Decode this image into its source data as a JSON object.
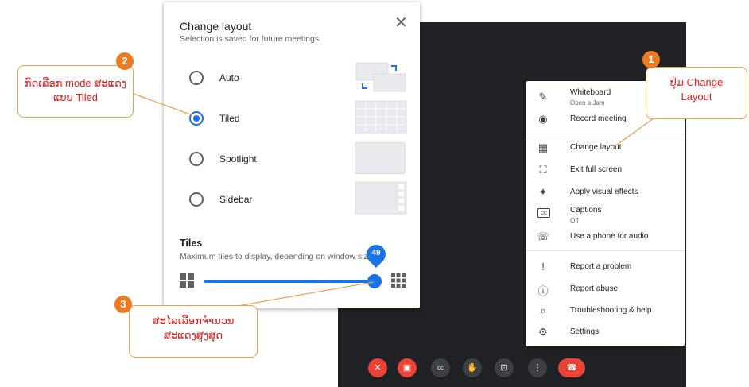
{
  "change_layout": {
    "title": "Change layout",
    "subtitle": "Selection is saved for future meetings",
    "close_icon": "close-icon",
    "options": [
      {
        "label": "Auto",
        "selected": false
      },
      {
        "label": "Tiled",
        "selected": true
      },
      {
        "label": "Spotlight",
        "selected": false
      },
      {
        "label": "Sidebar",
        "selected": false
      }
    ],
    "tiles_title": "Tiles",
    "tiles_desc": "Maximum tiles to display, depending on window size.",
    "slider_value": "49"
  },
  "menu": {
    "items": [
      {
        "icon": "pen-icon",
        "glyph": "✎",
        "label": "Whiteboard",
        "sub": "Open a Jam"
      },
      {
        "icon": "record-icon",
        "glyph": "◉",
        "label": "Record meeting"
      },
      {
        "icon": "layout-icon",
        "glyph": "▦",
        "label": "Change layout"
      },
      {
        "icon": "exit-fullscreen-icon",
        "glyph": "⛶",
        "label": "Exit full screen"
      },
      {
        "icon": "sparkle-icon",
        "glyph": "✦",
        "label": "Apply visual effects"
      },
      {
        "icon": "captions-icon",
        "glyph": "cc",
        "label": "Captions",
        "sub": "Off"
      },
      {
        "icon": "phone-icon",
        "glyph": "☏",
        "label": "Use a phone for audio"
      },
      {
        "icon": "report-problem-icon",
        "glyph": "!",
        "label": "Report a problem"
      },
      {
        "icon": "report-abuse-icon",
        "glyph": "ⓘ",
        "label": "Report abuse"
      },
      {
        "icon": "troubleshoot-icon",
        "glyph": "⌕",
        "label": "Troubleshooting & help"
      },
      {
        "icon": "settings-icon",
        "glyph": "⚙",
        "label": "Settings"
      }
    ]
  },
  "annotations": {
    "a1_num": "1",
    "a1_text": "ປຸ່ມ Change Layout",
    "a2_num": "2",
    "a2_text": "ກົດເລືອກ mode ສະແດງແບບ Tiled",
    "a3_num": "3",
    "a3_text": "ສະໄລເລືອກຈຳນວນ ສະແດງສູງສຸດ",
    "accent": "#ec7a22",
    "text_color": "#e02020"
  },
  "colors": {
    "primary": "#1a73e8",
    "meet_bg": "#202124",
    "end_call": "#ea4335"
  }
}
